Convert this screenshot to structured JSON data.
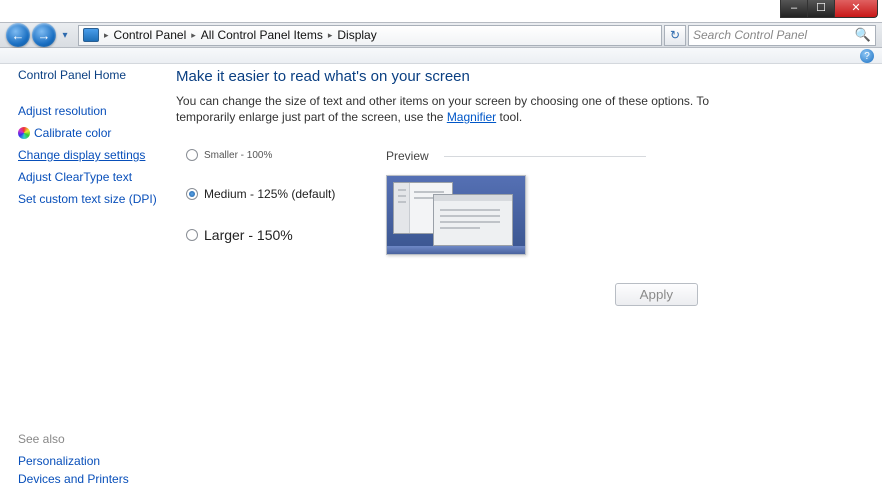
{
  "window": {
    "min_glyph": "–",
    "max_glyph": "☐",
    "close_glyph": "✕"
  },
  "navbar": {
    "back_glyph": "←",
    "fwd_glyph": "→",
    "drop_glyph": "▾",
    "refresh_glyph": "↻",
    "sep": "▸",
    "crumbs": [
      "Control Panel",
      "All Control Panel Items",
      "Display"
    ],
    "search_placeholder": "Search Control Panel"
  },
  "help_glyph": "?",
  "sidebar": {
    "home": "Control Panel Home",
    "links": {
      "adjust_resolution": "Adjust resolution",
      "calibrate_color": "Calibrate color",
      "change_display_settings": "Change display settings",
      "adjust_cleartype": "Adjust ClearType text",
      "custom_dpi": "Set custom text size (DPI)"
    },
    "see_also_label": "See also",
    "see_also": {
      "personalization": "Personalization",
      "devices_printers": "Devices and Printers"
    }
  },
  "main": {
    "title": "Make it easier to read what's on your screen",
    "desc_part1": "You can change the size of text and other items on your screen by choosing one of these options. To temporarily enlarge just part of the screen, use the ",
    "magnifier_link": "Magnifier",
    "desc_part2": " tool.",
    "options": {
      "smaller": "Smaller - 100%",
      "medium": "Medium - 125% (default)",
      "larger": "Larger - 150%",
      "selected": "medium"
    },
    "preview_label": "Preview",
    "apply_label": "Apply"
  }
}
